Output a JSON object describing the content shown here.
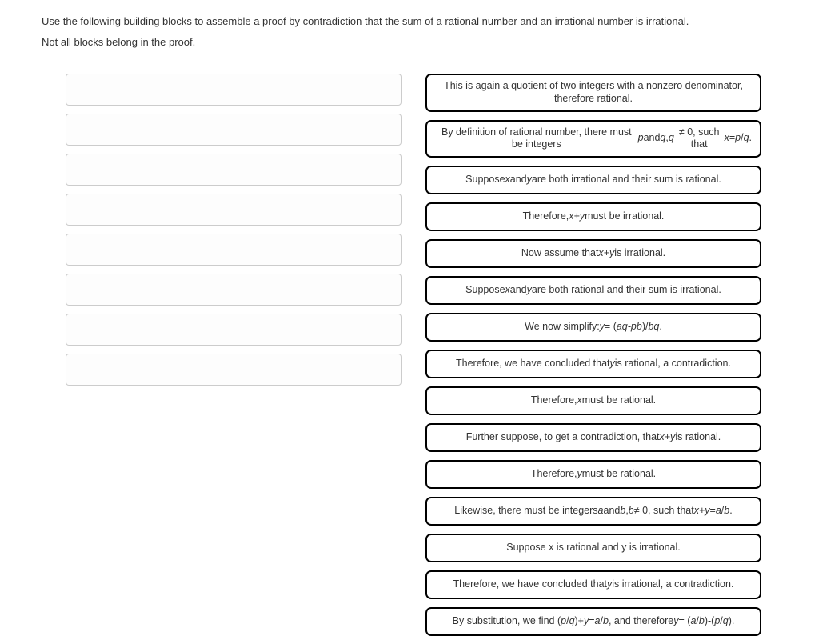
{
  "instructions": {
    "line1": "Use the following building blocks to assemble a proof by contradiction that the sum of a rational number and an irrational number is irrational.",
    "line2": "Not all blocks belong in the proof."
  },
  "slot_count": 8,
  "blocks": [
    {
      "html": "This is again a quotient of two integers with a nonzero denominator, therefore rational."
    },
    {
      "html": "By definition of rational number, there must be integers <span class='it'>p</span> and <span class='it'>q</span>, <span class='it'>q</span> ≠ 0, such that <span class='it'>x</span> = <span class='it'>p</span>/<span class='it'>q</span>."
    },
    {
      "html": "Suppose <span class='it'>x</span> and <span class='it'>y</span> are both irrational and their sum is rational."
    },
    {
      "html": "Therefore, <span class='it'>x+y</span> must be irrational."
    },
    {
      "html": "Now assume that <span class='it'>x+y</span> is irrational."
    },
    {
      "html": "Suppose <span class='it'>x</span> and <span class='it'>y</span> are both rational and their sum is irrational."
    },
    {
      "html": "We now simplify: <span class='it'>y</span> = (<span class='it'>aq-pb</span>)/<span class='it'>bq</span>."
    },
    {
      "html": "Therefore, we have concluded that <span class='it'>y</span> is rational, a contradiction."
    },
    {
      "html": "Therefore, <span class='it'>x</span> must be rational."
    },
    {
      "html": "Further suppose, to get a contradiction, that <span class='it'>x+y</span> is rational."
    },
    {
      "html": "Therefore, <span class='it'>y</span> must be rational."
    },
    {
      "html": "Likewise, there must be integers <span class='it'>a</span> and <span class='it'>b</span>, <span class='it'>b</span> ≠ 0, such that <span class='it'>x+y</span> = <span class='it'>a</span>/<span class='it'>b</span>."
    },
    {
      "html": "Suppose x is rational and y is irrational."
    },
    {
      "html": "Therefore, we have concluded that <span class='it'>y</span> is irrational, a contradiction."
    },
    {
      "html": "By substitution, we find (<span class='it'>p</span>/<span class='it'>q</span>)+<span class='it'>y</span> = <span class='it'>a</span>/<span class='it'>b</span>, and therefore <span class='it'>y</span> = (<span class='it'>a</span>/<span class='it'>b</span>)-(<span class='it'>p</span>/<span class='it'>q</span>)."
    }
  ]
}
